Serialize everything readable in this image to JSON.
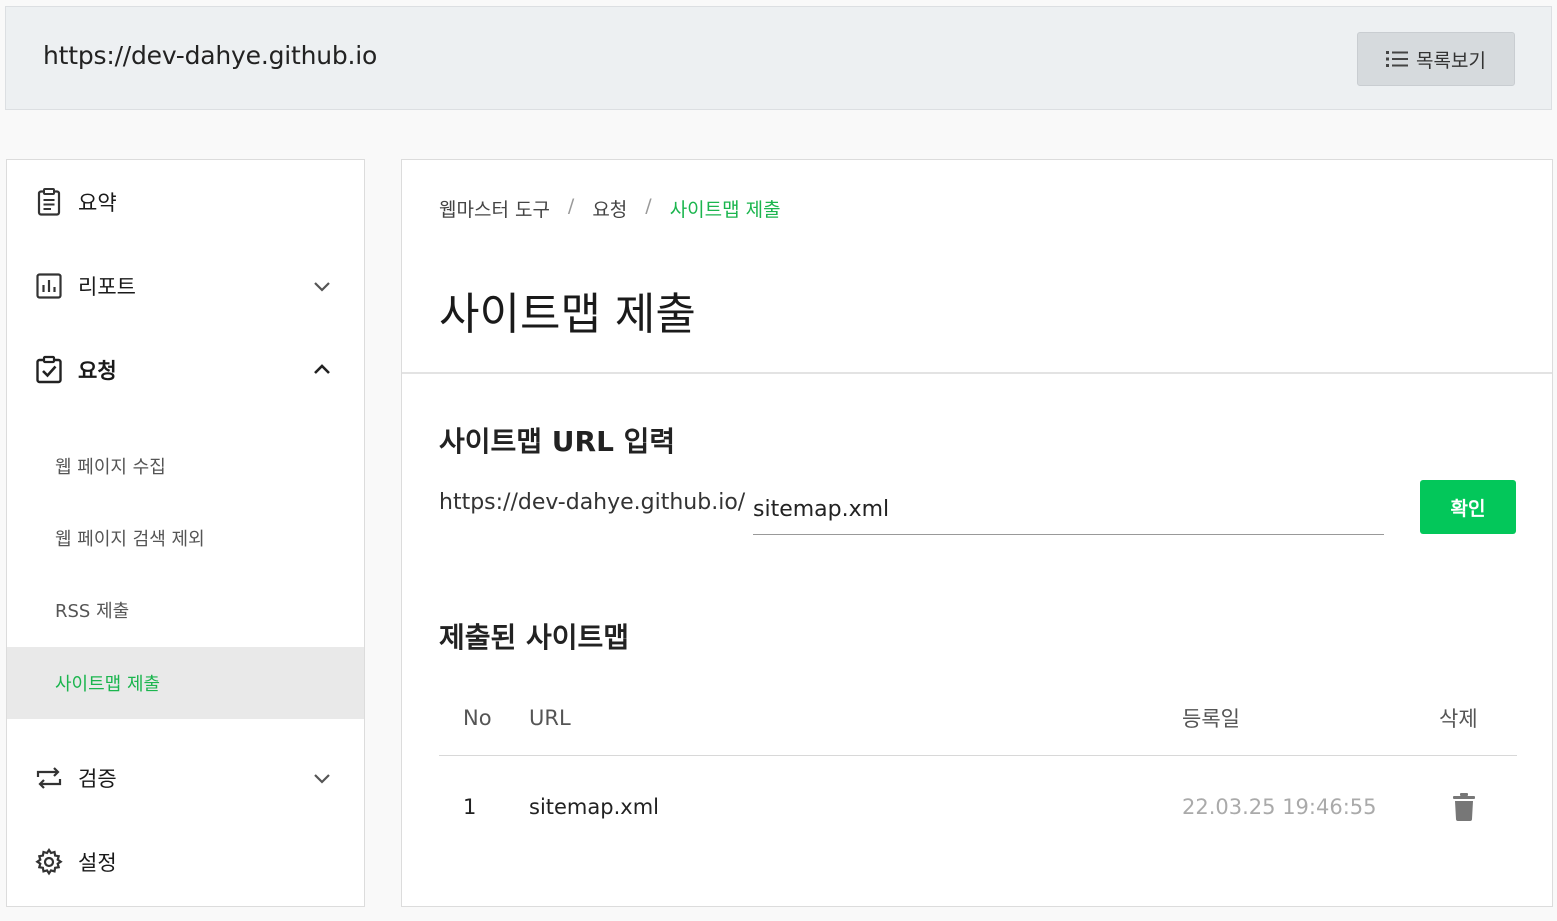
{
  "header": {
    "site_url": "https://dev-dahye.github.io",
    "list_button_label": "목록보기"
  },
  "sidebar": {
    "items": [
      {
        "label": "요약",
        "icon": "clipboard-icon"
      },
      {
        "label": "리포트",
        "icon": "bar-chart-icon",
        "expanded": false
      },
      {
        "label": "요청",
        "icon": "clipboard-check-icon",
        "expanded": true
      },
      {
        "label": "검증",
        "icon": "repeat-icon",
        "expanded": false
      },
      {
        "label": "설정",
        "icon": "gear-icon"
      }
    ],
    "sub_items": [
      {
        "label": "웹 페이지 수집",
        "active": false
      },
      {
        "label": "웹 페이지 검색 제외",
        "active": false
      },
      {
        "label": "RSS 제출",
        "active": false
      },
      {
        "label": "사이트맵 제출",
        "active": true
      }
    ]
  },
  "main": {
    "breadcrumb": [
      "웹마스터 도구",
      "요청",
      "사이트맵 제출"
    ],
    "breadcrumb_separator": "/",
    "title": "사이트맵 제출",
    "url_section": {
      "title": "사이트맵 URL 입력",
      "prefix": "https://dev-dahye.github.io/",
      "input_value": "sitemap.xml",
      "confirm_label": "확인"
    },
    "submitted_section": {
      "title": "제출된 사이트맵",
      "columns": [
        "No",
        "URL",
        "등록일",
        "삭제"
      ],
      "rows": [
        {
          "no": "1",
          "url": "sitemap.xml",
          "date": "22.03.25 19:46:55"
        }
      ]
    }
  },
  "colors": {
    "accent": "#03c75a",
    "active_text": "#1bb54e",
    "muted_date": "#aaaaaa"
  }
}
